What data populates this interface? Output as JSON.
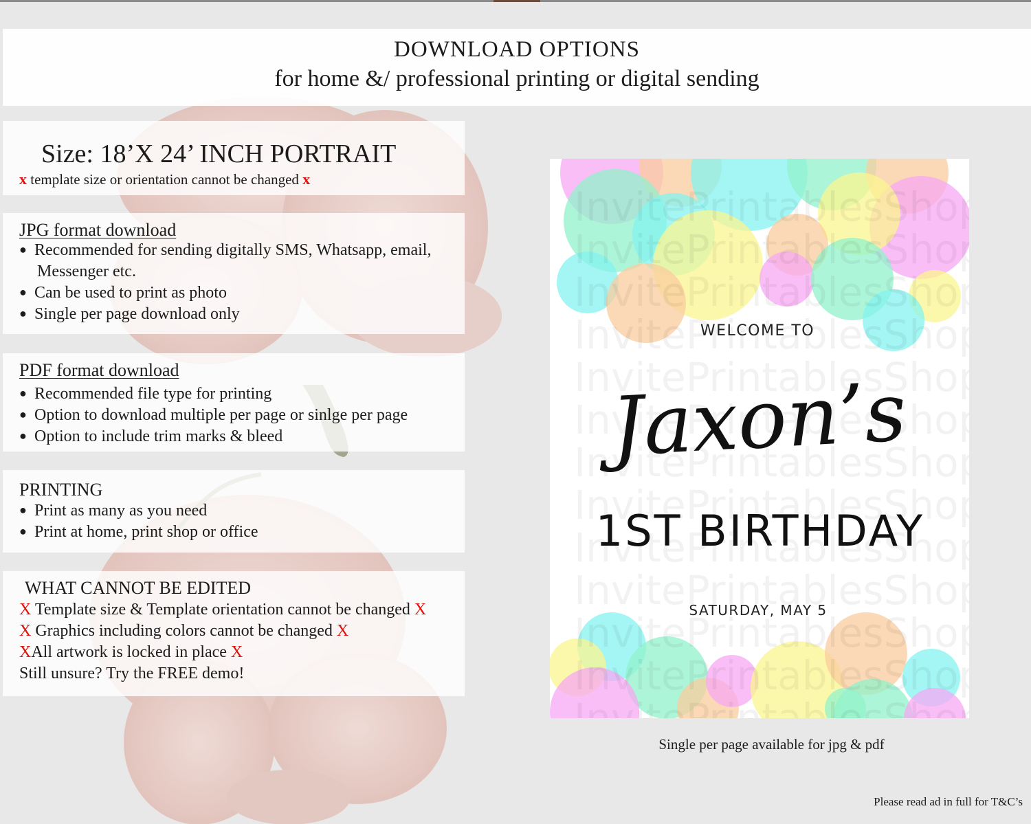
{
  "header": {
    "title": "DOWNLOAD OPTIONS",
    "subtitle": "for home &/ professional printing or digital sending"
  },
  "size_panel": {
    "heading": "Size: 18’X 24’ INCH PORTRAIT",
    "x_mark": "x",
    "note": "template size or orientation cannot be changed"
  },
  "jpg_panel": {
    "heading": "JPG format download",
    "items": [
      "Recommended for sending digitally SMS, Whatsapp, email,",
      "Messenger etc.",
      "Can be used to print as photo",
      "Single per page download only"
    ]
  },
  "pdf_panel": {
    "heading": "PDF format download",
    "items": [
      "Recommended file type for printing",
      "Option to download multiple per page or sinlge per page",
      "Option to include trim marks & bleed"
    ]
  },
  "printing_panel": {
    "heading": "PRINTING",
    "items": [
      "Print as many as you need",
      "Print at home, print shop or office"
    ]
  },
  "cannot_edit_panel": {
    "heading": "WHAT CANNOT BE EDITED",
    "x_mark": "X",
    "items": [
      "Template size & Template orientation cannot be changed",
      "Graphics including colors cannot be changed",
      "All artwork is locked in place"
    ],
    "footer": "Still unsure? Try the FREE demo!"
  },
  "preview": {
    "welcome": "WELCOME TO",
    "name": "Jaxon’s",
    "event": "1ST BIRTHDAY",
    "date": "SATURDAY, MAY 5",
    "watermark": "InvitePrintablesShop",
    "colors": {
      "pink": "#f59af2",
      "cyan": "#6ff2ee",
      "green": "#7ff0c2",
      "yellow": "#fbf47c",
      "orange": "#f9c48e"
    }
  },
  "caption": "Single per page available for jpg & pdf",
  "footer_note": "Please read ad in full for T&C’s"
}
